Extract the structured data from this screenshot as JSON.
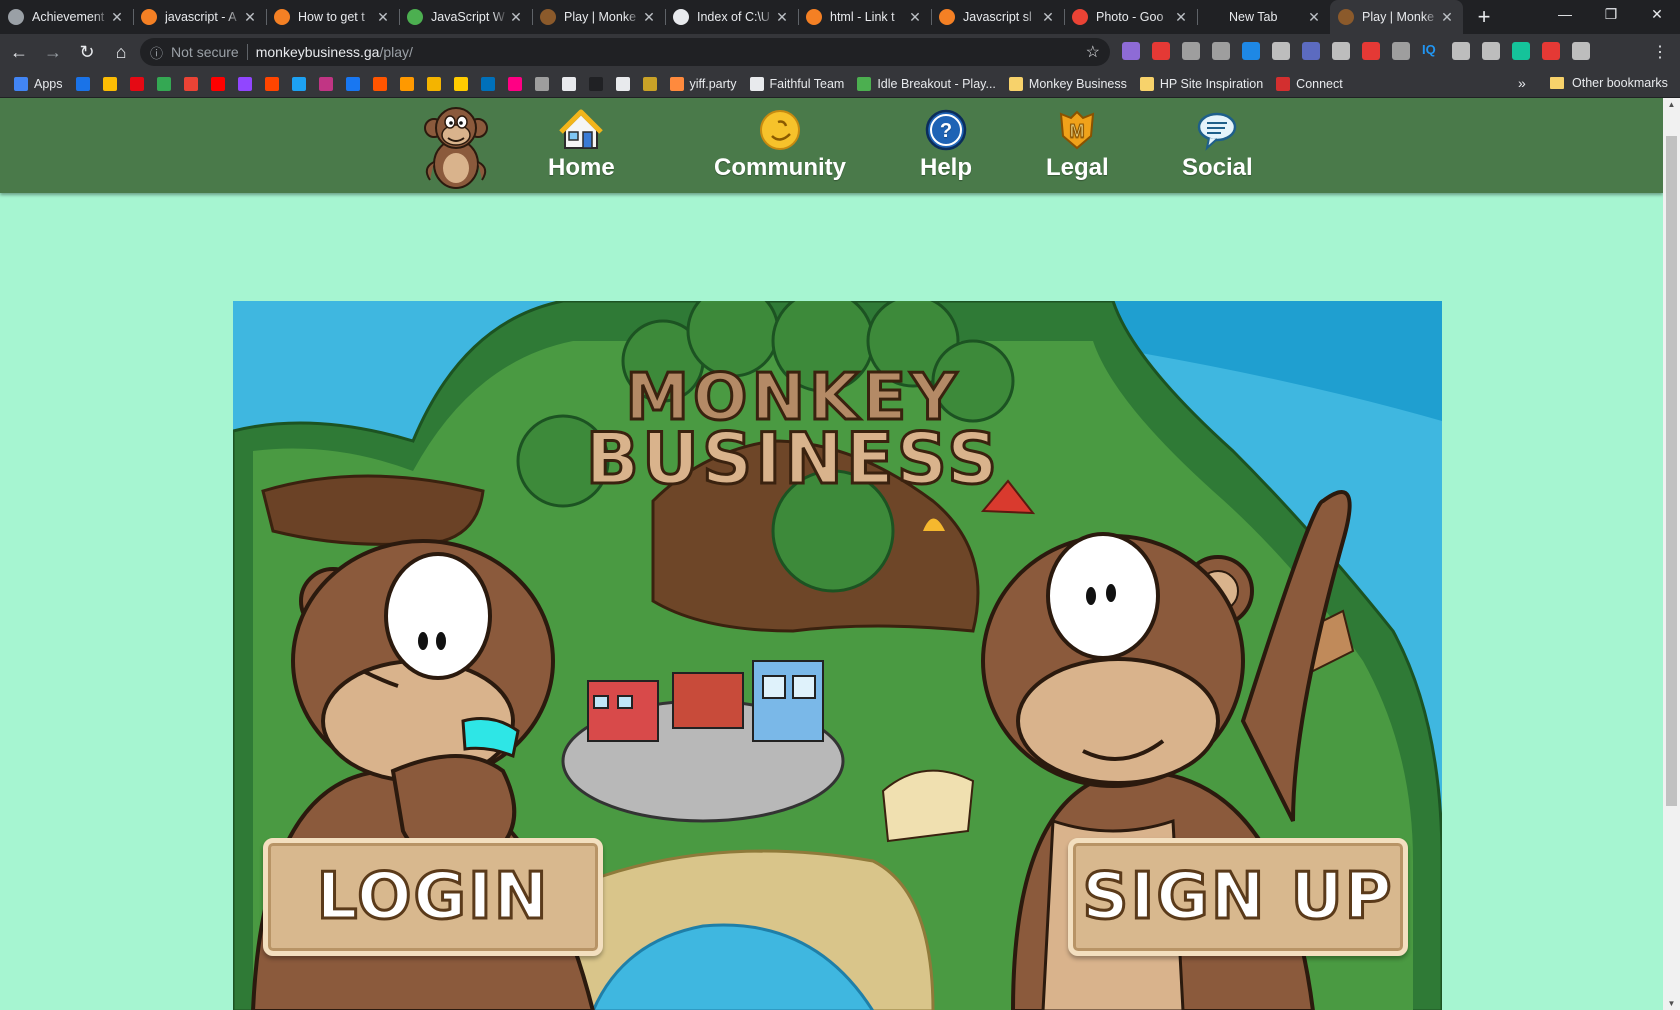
{
  "browser": {
    "tabs": [
      {
        "title": "Achievement",
        "favicon": "#9aa0a6",
        "active": false
      },
      {
        "title": "javascript - A",
        "favicon": "#f48024",
        "active": false
      },
      {
        "title": "How to get t",
        "favicon": "#f48024",
        "active": false
      },
      {
        "title": "JavaScript W",
        "favicon": "#4caf50",
        "active": false
      },
      {
        "title": "Play | Monke",
        "favicon": "#8b5a2b",
        "active": false
      },
      {
        "title": "Index of C:\\U",
        "favicon": "#e8eaed",
        "active": false
      },
      {
        "title": "html - Link t",
        "favicon": "#f48024",
        "active": false
      },
      {
        "title": "Javascript sl",
        "favicon": "#f48024",
        "active": false
      },
      {
        "title": "Photo - Goo",
        "favicon": "#ea4335",
        "active": false
      },
      {
        "title": "New Tab",
        "favicon": "",
        "active": false
      },
      {
        "title": "Play | Monke",
        "favicon": "#8b5a2b",
        "active": true
      }
    ],
    "new_tab_label": "+",
    "window_controls": [
      "—",
      "❐",
      "✕"
    ],
    "toolbar": {
      "back": "←",
      "forward": "→",
      "reload": "↻",
      "home": "⌂",
      "security_label": "Not secure",
      "url_domain": "monkeybusiness.ga",
      "url_path": "/play/",
      "star": "☆"
    },
    "extensions": [
      "#8e6bd6",
      "#e53935",
      "#9e9e9e",
      "#9e9e9e",
      "#1e88e5",
      "#bdbdbd",
      "#5c6bc0",
      "#bdbdbd",
      "#e53935",
      "#9e9e9e",
      "#2196f3",
      "#bdbdbd",
      "#bdbdbd",
      "#15c39a",
      "#e53935",
      "#bdbdbd"
    ],
    "ext_iq_label": "IQ",
    "bookmarks": [
      {
        "label": "Apps",
        "color": "#4285f4"
      },
      {
        "label": "",
        "color": "#1a73e8"
      },
      {
        "label": "",
        "color": "#fbbc04"
      },
      {
        "label": "",
        "color": "#e50914"
      },
      {
        "label": "",
        "color": "#34a853"
      },
      {
        "label": "",
        "color": "#ea4335"
      },
      {
        "label": "",
        "color": "#ff0000"
      },
      {
        "label": "",
        "color": "#9146ff"
      },
      {
        "label": "",
        "color": "#ff4500"
      },
      {
        "label": "",
        "color": "#1da1f2"
      },
      {
        "label": "",
        "color": "#c13584"
      },
      {
        "label": "",
        "color": "#1877f2"
      },
      {
        "label": "",
        "color": "#ff5500"
      },
      {
        "label": "",
        "color": "#ff9900"
      },
      {
        "label": "",
        "color": "#f4b400"
      },
      {
        "label": "",
        "color": "#ffcc00"
      },
      {
        "label": "",
        "color": "#0070ba"
      },
      {
        "label": "",
        "color": "#ff0084"
      },
      {
        "label": "",
        "color": "#9e9e9e"
      },
      {
        "label": "",
        "color": "#e8eaed"
      },
      {
        "label": "",
        "color": "#202124"
      },
      {
        "label": "",
        "color": "#e8eaed"
      },
      {
        "label": "",
        "color": "#c9a227"
      },
      {
        "label": "yiff.party",
        "color": "#ff8a3d"
      },
      {
        "label": "Faithful Team",
        "color": "#e8eaed"
      },
      {
        "label": "Idle Breakout - Play...",
        "color": "#4caf50"
      },
      {
        "label": "Monkey Business",
        "color": "#f7d26b"
      },
      {
        "label": "HP Site Inspiration",
        "color": "#f7d26b"
      },
      {
        "label": "Connect",
        "color": "#d32f2f"
      }
    ],
    "bookmarks_more": "»",
    "other_bookmarks": "Other bookmarks"
  },
  "site": {
    "nav": [
      {
        "label": "Home",
        "icon": "house-icon"
      },
      {
        "label": "Community",
        "icon": "smiley-icon"
      },
      {
        "label": "Help",
        "icon": "question-icon"
      },
      {
        "label": "Legal",
        "icon": "badge-icon"
      },
      {
        "label": "Social",
        "icon": "speech-bubble-icon"
      }
    ],
    "game": {
      "title_line1": "MONKEY",
      "title_line2": "BUSINESS",
      "login_label": "Login",
      "signup_label": "Sign Up"
    }
  },
  "colors": {
    "page_bg": "#a6f5d1",
    "nav_bg": "#4a7a4a",
    "ocean": "#3fb7e0",
    "jungle": "#3f8a3a",
    "monkey_brown": "#8b5a3c",
    "monkey_face": "#d9b38c",
    "button_tan": "#d8b88e"
  }
}
